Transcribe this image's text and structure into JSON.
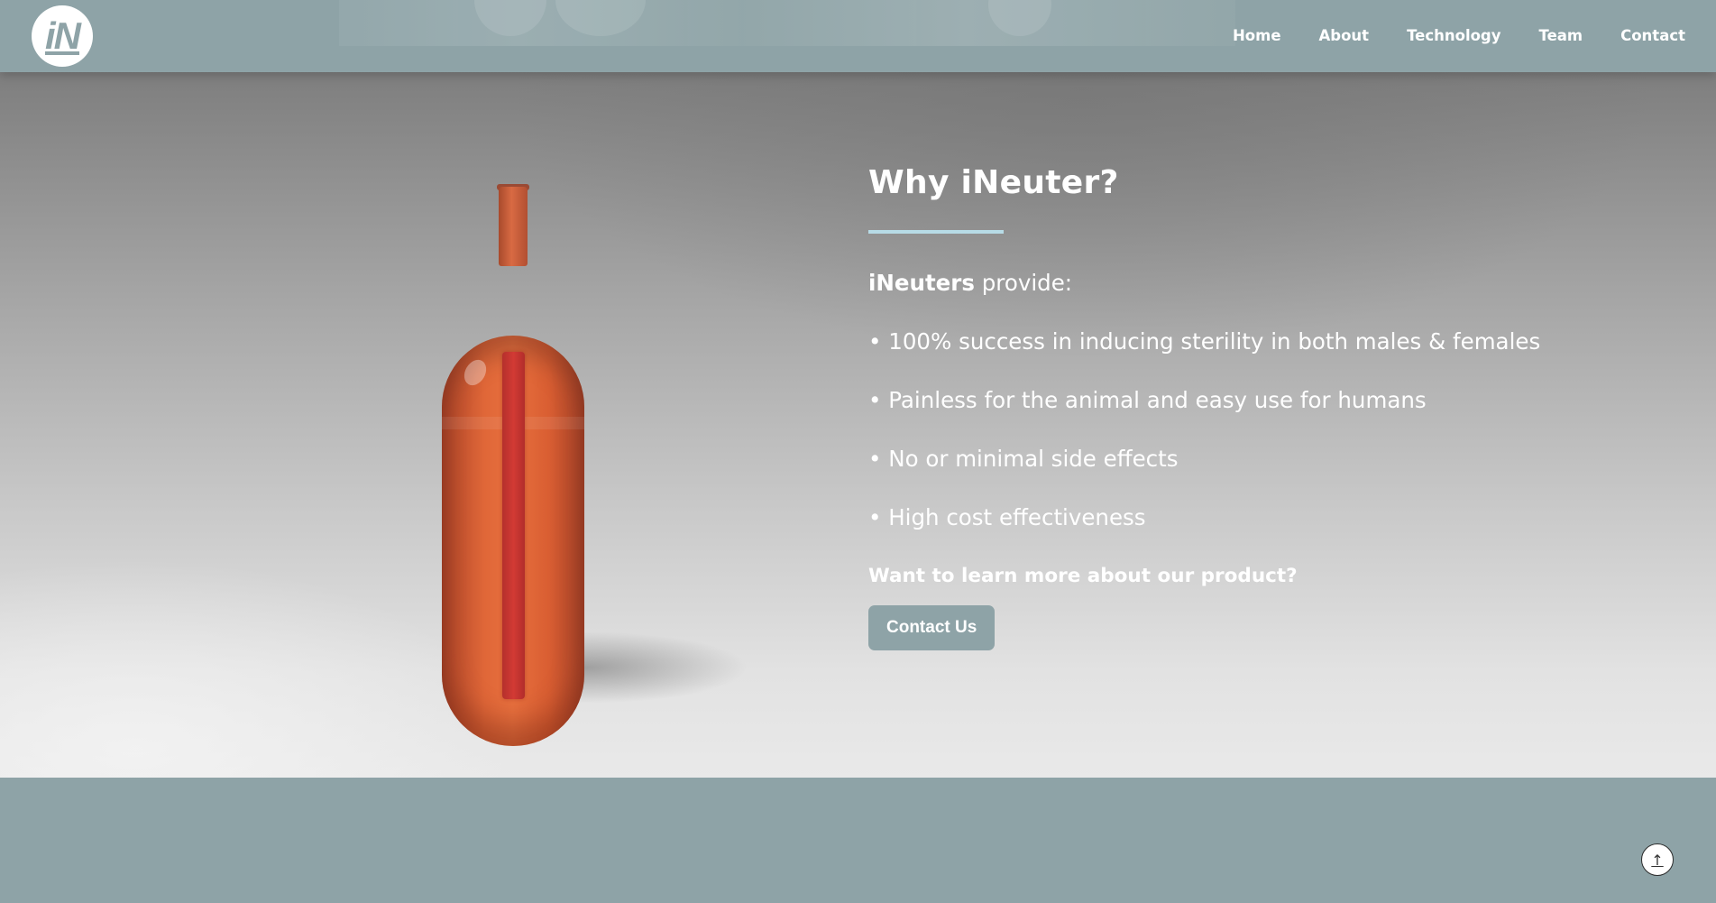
{
  "header": {
    "logo_text": "iN",
    "nav": [
      {
        "label": "Home"
      },
      {
        "label": "About"
      },
      {
        "label": "Technology"
      },
      {
        "label": "Team"
      },
      {
        "label": "Contact"
      }
    ]
  },
  "main": {
    "title": "Why iNeuter?",
    "intro_bold": "iNeuters",
    "intro_rest": " provide:",
    "bullets": [
      "• 100% success in inducing sterility in both males & females",
      "• Painless for the animal and easy use for humans",
      "• No or minimal side effects",
      "• High cost effectiveness"
    ],
    "cta_text": "Want to learn more about our product?",
    "contact_button_label": "Contact Us"
  },
  "footer": {
    "back_to_top_icon": "arrow-up-icon",
    "back_to_top_glyph": "↑"
  },
  "colors": {
    "brand": "#8ea3a7",
    "accent_rule": "#b7dbe6",
    "product_orange": "#e06738",
    "rod_red": "#d23a34"
  }
}
